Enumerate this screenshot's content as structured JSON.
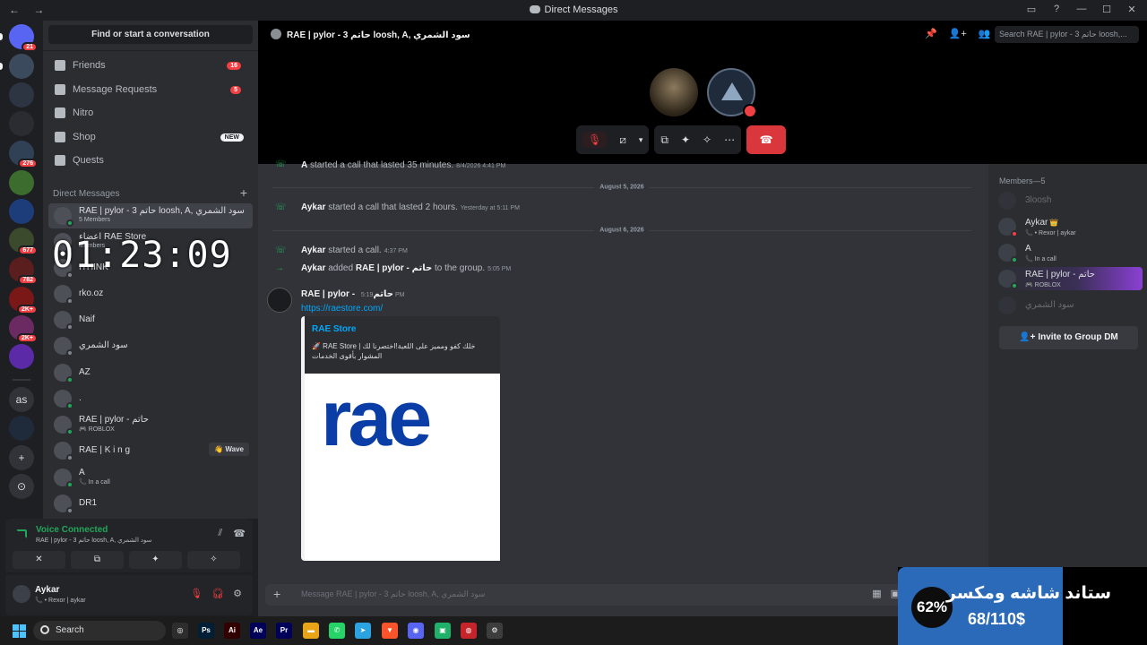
{
  "window": {
    "title": "Direct Messages",
    "nav_arrows": "← →",
    "controls": [
      "▭",
      "?",
      "—",
      "☐",
      "✕"
    ]
  },
  "guilds": [
    {
      "name": "discord-home",
      "badge": "21",
      "color": "#5865f2"
    },
    {
      "name": "server",
      "badge": "",
      "color": "#3b4a5c"
    },
    {
      "name": "server",
      "badge": "",
      "color": "#2d3442"
    },
    {
      "name": "server",
      "badge": "",
      "color": "#2a2c31"
    },
    {
      "name": "server",
      "badge": "276",
      "color": "#304055"
    },
    {
      "name": "server",
      "badge": "",
      "color": "#3c6d2f"
    },
    {
      "name": "server",
      "badge": "",
      "color": "#1d3d7a"
    },
    {
      "name": "server",
      "badge": "677",
      "color": "#3b4a2c"
    },
    {
      "name": "server",
      "badge": "782",
      "color": "#5a1e1e"
    },
    {
      "name": "server",
      "badge": "2K+",
      "color": "#7a1818"
    },
    {
      "name": "server",
      "badge": "2K+",
      "color": "#6b2a62"
    },
    {
      "name": "server",
      "badge": "",
      "color": "#5b2aa6"
    },
    {
      "name": "server-as",
      "badge": "",
      "color": "#313338",
      "text": "as"
    },
    {
      "name": "server",
      "badge": "",
      "color": "#1f2b3a"
    },
    {
      "name": "add-server",
      "badge": "",
      "color": "#313338",
      "text": "+"
    },
    {
      "name": "explore",
      "badge": "",
      "color": "#313338",
      "text": "⊙"
    }
  ],
  "dm_panel": {
    "search_label": "Find or start a conversation",
    "nav": [
      {
        "label": "Friends",
        "badge": "16"
      },
      {
        "label": "Message Requests",
        "badge": "5"
      },
      {
        "label": "Nitro",
        "badge": ""
      },
      {
        "label": "Shop",
        "new": "NEW"
      },
      {
        "label": "Quests",
        "badge": ""
      }
    ],
    "section_header": "Direct Messages",
    "dms": [
      {
        "name": "RAE | pylor - 3 حاتم loosh, A, سود الشمري",
        "sub": "5 Members",
        "status": "online"
      },
      {
        "name": "اعضاء RAE Store",
        "sub": "Members",
        "status": "offline"
      },
      {
        "name": "ITHINK",
        "sub": "",
        "status": "offline"
      },
      {
        "name": "rko.oz",
        "sub": "",
        "status": "offline"
      },
      {
        "name": "Naif",
        "sub": "",
        "status": "offline"
      },
      {
        "name": "سود الشمري",
        "sub": "",
        "status": "offline"
      },
      {
        "name": "AZ",
        "sub": "",
        "status": "online"
      },
      {
        "name": ".",
        "sub": "",
        "status": "online"
      },
      {
        "name": "RAE | pylor - حاتم",
        "sub": "🎮 ROBLOX",
        "status": "online"
      },
      {
        "name": "RAE | K i n g",
        "sub": "",
        "status": "offline",
        "wave": "👋 Wave"
      },
      {
        "name": "A",
        "sub": "📞 In a call",
        "status": "online"
      },
      {
        "name": "DR1",
        "sub": "",
        "status": "offline"
      }
    ]
  },
  "overlay_timer": "01:23:09",
  "voice": {
    "status": "Voice Connected",
    "channel": "RAE | pylor - 3 حاتم loosh, A, سود الشمري",
    "buttons": [
      "✕",
      "⧉",
      "✦",
      "✧"
    ]
  },
  "user": {
    "name": "Aykar",
    "status": "📞 • Rexor | aykar"
  },
  "call": {
    "title": "RAE | pylor - 3 حاتم loosh, A, سود الشمري",
    "search_placeholder": "Search RAE | pylor - 3 حاتم loosh,...",
    "header_icons": [
      "📌",
      "👤+",
      "👥"
    ],
    "controls": {
      "mute": "🎙",
      "video": "⧄",
      "share": "⧉",
      "activities": "✦",
      "soundboard": "✧",
      "more": "⋯",
      "hangup": "☎"
    }
  },
  "messages": {
    "line0": {
      "user": "A",
      "text": "started a call that lasted 35 minutes.",
      "ts": "8/4/2026 4:41 PM"
    },
    "date1": "August 5, 2026",
    "line1": {
      "user": "Aykar",
      "text": "started a call that lasted 2 hours.",
      "ts": "Yesterday at 5:11 PM"
    },
    "date2": "August 6, 2026",
    "line2": {
      "user": "Aykar",
      "text": "started a call.",
      "ts": "4:37 PM"
    },
    "line3": {
      "user": "Aykar",
      "text": "added",
      "target": "RAE | pylor - حاتم",
      "text2": "to the group.",
      "ts": "5:05 PM"
    },
    "post": {
      "user": "RAE | pylor - حاتم",
      "ts": "5:19 PM",
      "link": "https://raestore.com/",
      "embed_title": "RAE Store",
      "embed_desc": "🚀 RAE Store | خلك كفو ومميز على اللعبة!اختصرنا لك المشوار بأقوى الخدمات",
      "logo_text": "rae"
    }
  },
  "composer": {
    "placeholder": "Message RAE | pylor - 3 حاتم loosh, A, سود الشمري"
  },
  "members": {
    "header": "Members—5",
    "list": [
      {
        "name": "3loosh",
        "sub": "",
        "dim": true
      },
      {
        "name": "Aykar",
        "crown": "👑",
        "sub": "📞 • Rexor | aykar",
        "status": "dnd"
      },
      {
        "name": "A",
        "sub": "📞 In a call",
        "status": "online"
      },
      {
        "name": "RAE | pylor - حاتم",
        "sub": "🎮 ROBLOX",
        "status": "online",
        "highlight": true
      },
      {
        "name": "سود الشمري",
        "sub": "",
        "dim": true
      }
    ],
    "invite_label": "Invite to Group DM"
  },
  "promo": {
    "percent": "62%",
    "title": "ستاند شاشه ومكسر",
    "price": "68/110$"
  },
  "taskbar": {
    "search_label": "Search",
    "apps": [
      {
        "name": "chrome",
        "text": "◎",
        "color": "#2d2d2d"
      },
      {
        "name": "photoshop",
        "text": "Ps",
        "color": "#001e36"
      },
      {
        "name": "illustrator",
        "text": "Ai",
        "color": "#330000"
      },
      {
        "name": "after-effects",
        "text": "Ae",
        "color": "#00005b"
      },
      {
        "name": "premiere",
        "text": "Pr",
        "color": "#00005b"
      },
      {
        "name": "file-explorer",
        "text": "▬",
        "color": "#e8a317"
      },
      {
        "name": "whatsapp",
        "text": "✆",
        "color": "#25d366"
      },
      {
        "name": "telegram",
        "text": "➤",
        "color": "#2aa3e0"
      },
      {
        "name": "brave",
        "text": "▼",
        "color": "#fb542b"
      },
      {
        "name": "discord",
        "text": "◉",
        "color": "#5865f2"
      },
      {
        "name": "app-green",
        "text": "▣",
        "color": "#1fb06a"
      },
      {
        "name": "app-red",
        "text": "◍",
        "color": "#c5242b"
      },
      {
        "name": "settings",
        "text": "⚙",
        "color": "#3d3d3d"
      }
    ]
  }
}
